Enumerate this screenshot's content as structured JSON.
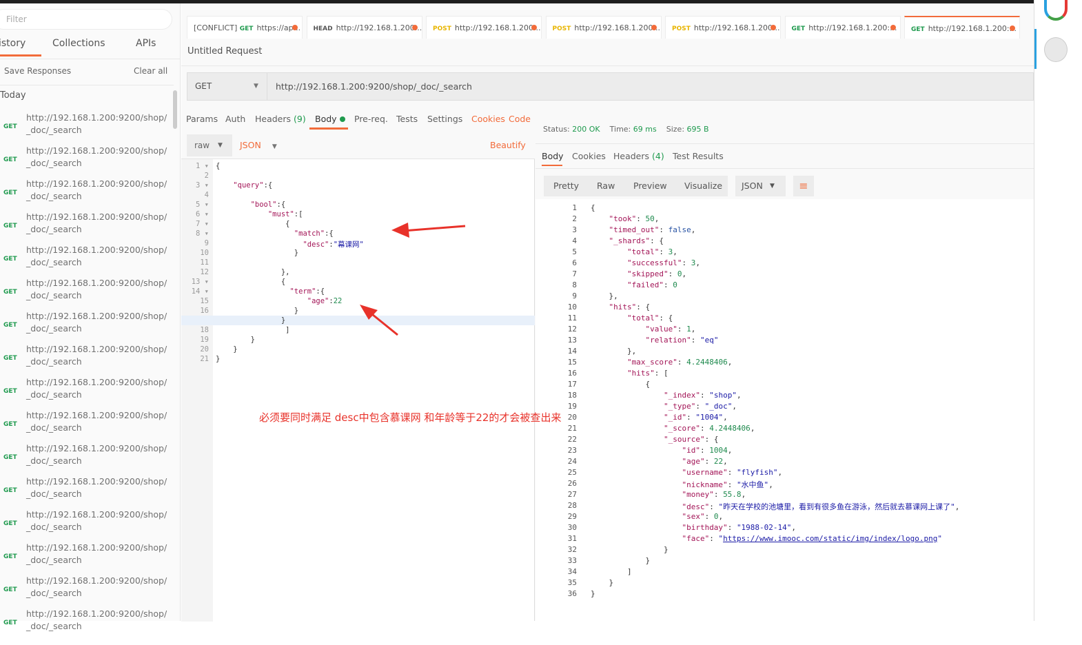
{
  "sidebar": {
    "filter_placeholder": "Filter",
    "tabs": [
      "istory",
      "Collections",
      "APIs"
    ],
    "save_responses": "Save Responses",
    "clear_all": "Clear all",
    "group": "Today",
    "items": [
      {
        "method": "GET",
        "url": "http://192.168.1.200:9200/shop/_doc/_search"
      },
      {
        "method": "GET",
        "url": "http://192.168.1.200:9200/shop/_doc/_search"
      },
      {
        "method": "GET",
        "url": "http://192.168.1.200:9200/shop/_doc/_search"
      },
      {
        "method": "GET",
        "url": "http://192.168.1.200:9200/shop/_doc/_search"
      },
      {
        "method": "GET",
        "url": "http://192.168.1.200:9200/shop/_doc/_search"
      },
      {
        "method": "GET",
        "url": "http://192.168.1.200:9200/shop/_doc/_search"
      },
      {
        "method": "GET",
        "url": "http://192.168.1.200:9200/shop/_doc/_search"
      },
      {
        "method": "GET",
        "url": "http://192.168.1.200:9200/shop/_doc/_search"
      },
      {
        "method": "GET",
        "url": "http://192.168.1.200:9200/shop/_doc/_search"
      },
      {
        "method": "GET",
        "url": "http://192.168.1.200:9200/shop/_doc/_search"
      },
      {
        "method": "GET",
        "url": "http://192.168.1.200:9200/shop/_doc/_search"
      },
      {
        "method": "GET",
        "url": "http://192.168.1.200:9200/shop/_doc/_search"
      },
      {
        "method": "GET",
        "url": "http://192.168.1.200:9200/shop/_doc/_search"
      },
      {
        "method": "GET",
        "url": "http://192.168.1.200:9200/shop/_doc/_search"
      },
      {
        "method": "GET",
        "url": "http://192.168.1.200:9200/shop/_doc/_search"
      },
      {
        "method": "GET",
        "url": "http://192.168.1.200:9200/shop/_doc/_search"
      }
    ]
  },
  "tabs": [
    {
      "prefix": "[CONFLICT]",
      "method": "GET",
      "color": "#1f9a4e",
      "url": "https://ap..."
    },
    {
      "prefix": "",
      "method": "HEAD",
      "color": "#555555",
      "url": "http://192.168.1.200..."
    },
    {
      "prefix": "",
      "method": "POST",
      "color": "#e8b500",
      "url": "http://192.168.1.200..."
    },
    {
      "prefix": "",
      "method": "POST",
      "color": "#e8b500",
      "url": "http://192.168.1.200..."
    },
    {
      "prefix": "",
      "method": "POST",
      "color": "#e8b500",
      "url": "http://192.168.1.200..."
    },
    {
      "prefix": "",
      "method": "GET",
      "color": "#1f9a4e",
      "url": "http://192.168.1.200:..."
    },
    {
      "prefix": "",
      "method": "GET",
      "color": "#1f9a4e",
      "url": "http://192.168.1.200:...",
      "active": true
    }
  ],
  "request": {
    "title": "Untitled Request",
    "method": "GET",
    "url": "http://192.168.1.200:9200/shop/_doc/_search",
    "tabs": {
      "params": "Params",
      "auth": "Auth",
      "headers": "Headers",
      "headers_count": "(9)",
      "body": "Body",
      "prereq": "Pre-req.",
      "tests": "Tests",
      "settings": "Settings",
      "cookies": "Cookies",
      "code": "Code"
    },
    "body_mode": "raw",
    "body_lang": "JSON",
    "beautify": "Beautify",
    "code": [
      "{",
      "",
      "    \"query\":{",
      "",
      "        \"bool\":{",
      "            \"must\":[",
      "                {",
      "                  \"match\":{",
      "                    \"desc\":\"幕课网\"",
      "                  }",
      "",
      "               },",
      "               {",
      "                 \"term\":{",
      "                     \"age\":22",
      "                  }",
      "               } ",
      "                ]",
      "        }",
      "    }",
      "}"
    ],
    "current_line": 17
  },
  "response": {
    "status_label": "Status:",
    "status": "200 OK",
    "time_label": "Time:",
    "time": "69 ms",
    "size_label": "Size:",
    "size": "695 B",
    "tabs": {
      "body": "Body",
      "cookies": "Cookies",
      "headers": "Headers",
      "headers_count": "(4)",
      "tests": "Test Results"
    },
    "views": [
      "Pretty",
      "Raw",
      "Preview",
      "Visualize"
    ],
    "format": "JSON",
    "code": [
      "{",
      "    \"took\": 50,",
      "    \"timed_out\": false,",
      "    \"_shards\": {",
      "        \"total\": 3,",
      "        \"successful\": 3,",
      "        \"skipped\": 0,",
      "        \"failed\": 0",
      "    },",
      "    \"hits\": {",
      "        \"total\": {",
      "            \"value\": 1,",
      "            \"relation\": \"eq\"",
      "        },",
      "        \"max_score\": 4.2448406,",
      "        \"hits\": [",
      "            {",
      "                \"_index\": \"shop\",",
      "                \"_type\": \"_doc\",",
      "                \"_id\": \"1004\",",
      "                \"_score\": 4.2448406,",
      "                \"_source\": {",
      "                    \"id\": 1004,",
      "                    \"age\": 22,",
      "                    \"username\": \"flyfish\",",
      "                    \"nickname\": \"水中鱼\",",
      "                    \"money\": 55.8,",
      "                    \"desc\": \"昨天在学校的池塘里，看到有很多鱼在游泳，然后就去慕课网上课了\",",
      "                    \"sex\": 0,",
      "                    \"birthday\": \"1988-02-14\",",
      "                    \"face\": \"https://www.imooc.com/static/img/index/logo.png\"",
      "                }",
      "            }",
      "        ]",
      "    }",
      "}"
    ]
  },
  "annotation": "必须要同时满足 desc中包含慕课网  和年龄等于22的才会被查出来",
  "colors": {
    "accent": "#f26b3a",
    "success": "#1f9a4e",
    "annotation": "#e8322a"
  }
}
